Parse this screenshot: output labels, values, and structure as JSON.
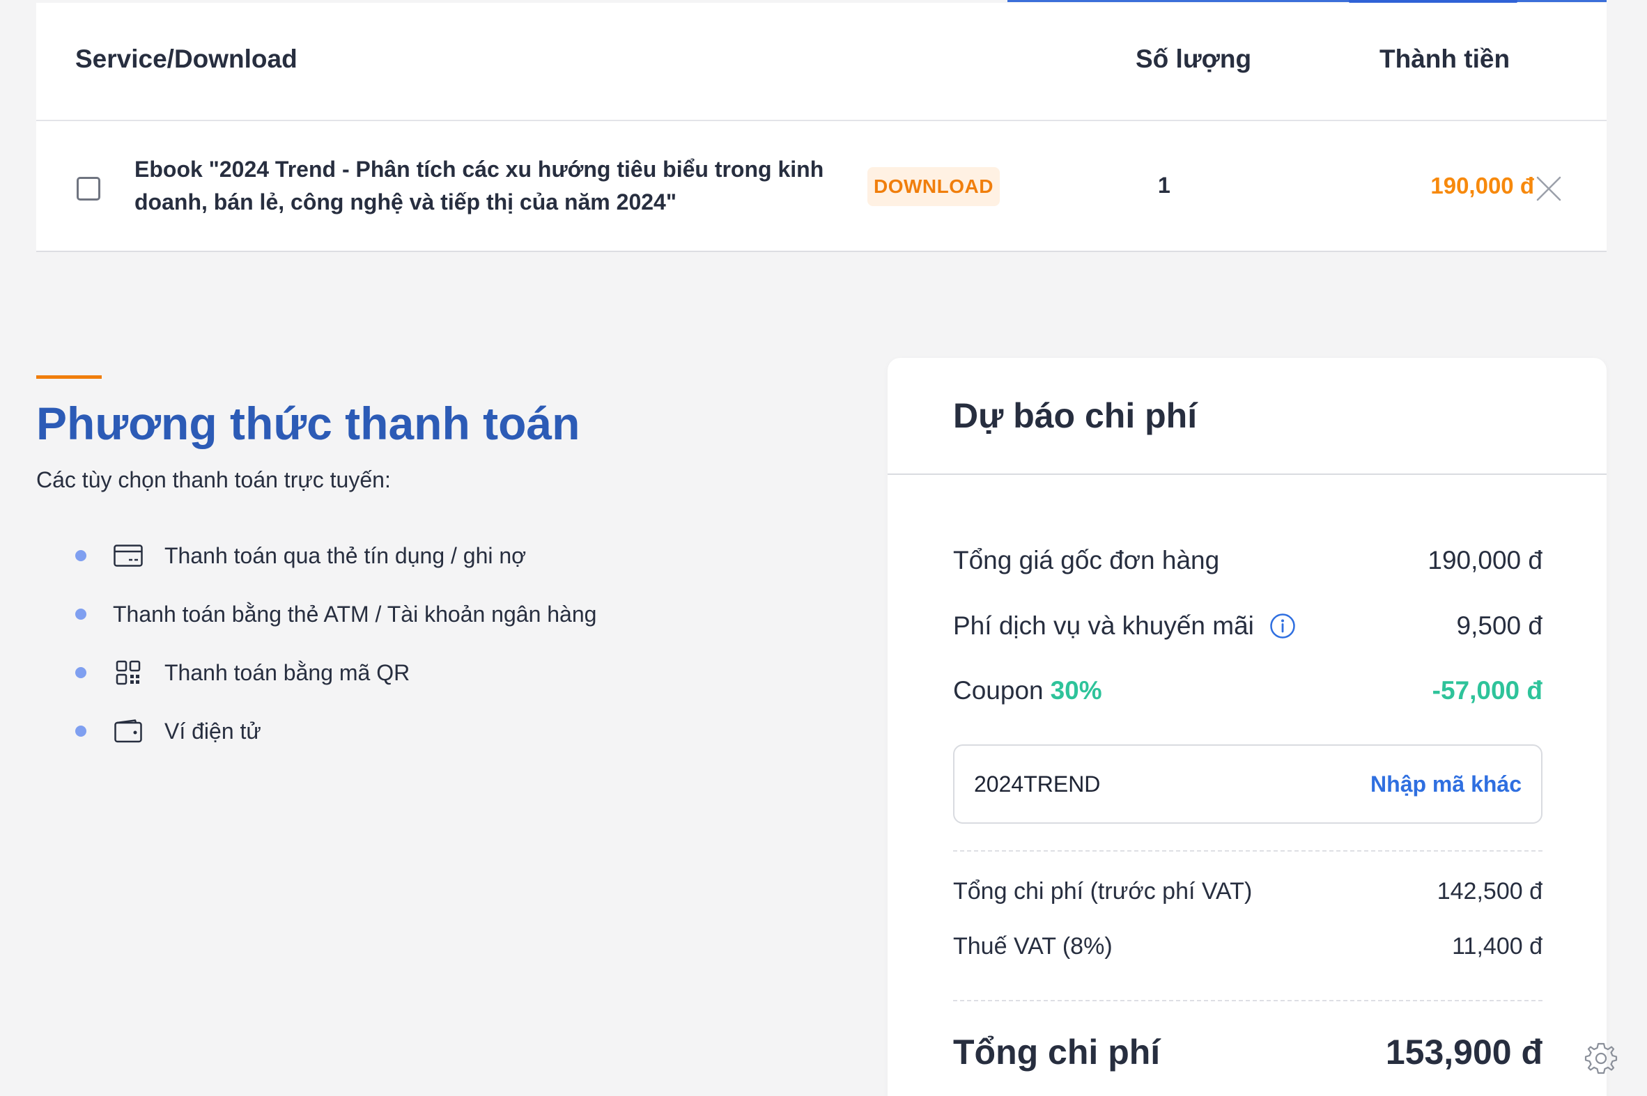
{
  "cart": {
    "headers": {
      "service": "Service/Download",
      "quantity": "Số lượng",
      "total": "Thành tiền"
    },
    "items": [
      {
        "title": "Ebook \"2024 Trend - Phân tích các xu hướng tiêu biểu trong kinh doanh, bán lẻ, công nghệ và tiếp thị của năm 2024\"",
        "badge": "DOWNLOAD",
        "quantity": "1",
        "price": "190,000 đ",
        "checked": false,
        "remove_icon": "close-icon"
      }
    ]
  },
  "payment": {
    "title": "Phương thức thanh toán",
    "subtitle": "Các tùy chọn thanh toán trực tuyến:",
    "methods": [
      {
        "label": "Thanh toán qua thẻ tín dụng / ghi nợ",
        "icon": "credit-card-icon"
      },
      {
        "label": "Thanh toán bằng thẻ ATM / Tài khoản ngân hàng",
        "icon": ""
      },
      {
        "label": "Thanh toán bằng mã QR",
        "icon": "qr-code-icon"
      },
      {
        "label": "Ví điện tử",
        "icon": "wallet-icon"
      }
    ]
  },
  "cost": {
    "title": "Dự báo chi phí",
    "original_label": "Tổng giá gốc đơn hàng",
    "original_value": "190,000 đ",
    "service_label": "Phí dịch vụ và khuyến mãi",
    "service_value": "9,500 đ",
    "coupon_label": "Coupon",
    "coupon_percent": "30%",
    "coupon_value": "-57,000 đ",
    "coupon_code": "2024TREND",
    "coupon_change": "Nhập mã khác",
    "subtotal_label": "Tổng chi phí (trước phí VAT)",
    "subtotal_value": "142,500 đ",
    "vat_label": "Thuế VAT (8%)",
    "vat_value": "11,400 đ",
    "total_label": "Tổng chi phí",
    "total_value": "153,900 đ"
  },
  "colors": {
    "accent_blue": "#2c5bb6",
    "link_blue": "#2f6fe0",
    "orange": "#f7890c",
    "green": "#2ec39a",
    "bullet": "#7f9ff0"
  }
}
